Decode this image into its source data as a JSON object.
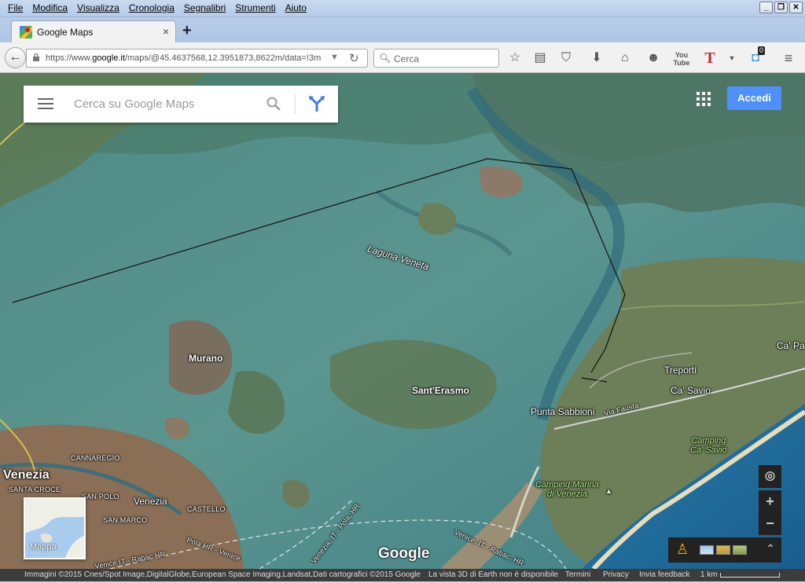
{
  "menu": [
    "File",
    "Modifica",
    "Visualizza",
    "Cronologia",
    "Segnalibri",
    "Strumenti",
    "Aiuto"
  ],
  "window_buttons": [
    "_",
    "❐",
    "✕"
  ],
  "tab": {
    "title": "Google Maps",
    "close": "×"
  },
  "new_tab": "+",
  "nav": {
    "back": "←",
    "url_prefix": "https://www.",
    "url_domain": "google.it",
    "url_rest": "/maps/@45.4637568,12.3951873,8622m/data=!3m",
    "search_placeholder": "Cerca",
    "badge_count": "0",
    "toolbar_icons": [
      "star-icon",
      "reading-list-icon",
      "pocket-icon",
      "download-icon",
      "home-icon",
      "chat-icon",
      "youtube-icon",
      "translate-icon",
      "extension-icon",
      "menu-icon"
    ]
  },
  "maps": {
    "search_placeholder": "Cerca su Google Maps",
    "signin": "Accedi",
    "minimap_label": "Mappa",
    "logo": "Google",
    "labels": {
      "laguna": "Laguna Veneta",
      "murano": "Murano",
      "venezia_big": "Venezia",
      "venezia": "Venezia",
      "santa_croce": "SANTA CROCE",
      "cannaregio": "CANNAREGIO",
      "san_polo": "SAN POLO",
      "san_marco": "SAN MARCO",
      "castello": "CASTELLO",
      "sant_erasmo": "Sant'Erasmo",
      "punta_sabbioni": "Punta Sabbioni",
      "treporti": "Treporti",
      "ca_savio": "Ca' Savio",
      "ca_pa": "Ca' Pa",
      "via_fausta": "Via Fausta",
      "camping_cavallino": "Camping\nCa' Savio",
      "camping_marina": "Camping Marina\ndi Venezia",
      "ferry1": "Venice IT - Rabac HR",
      "ferry2": "Pola HR - Venice",
      "ferry3": "Venezia, IT - Pola, HR",
      "ferry4": "Venice, IT - Rabac, HR"
    },
    "controls": {
      "locate": "◎",
      "zoom_in": "+",
      "zoom_out": "−",
      "expand": "⌃"
    }
  },
  "footer": {
    "imagery": "Immagini ©2015 Cnes/Spot Image,DigitalGlobe,European Space Imaging,Landsat,Dati cartografici ©2015 Google",
    "earth_note": "La vista 3D di Earth non è disponibile",
    "terms": "Termini",
    "privacy": "Privacy",
    "feedback": "Invia feedback",
    "scale": "1 km"
  }
}
